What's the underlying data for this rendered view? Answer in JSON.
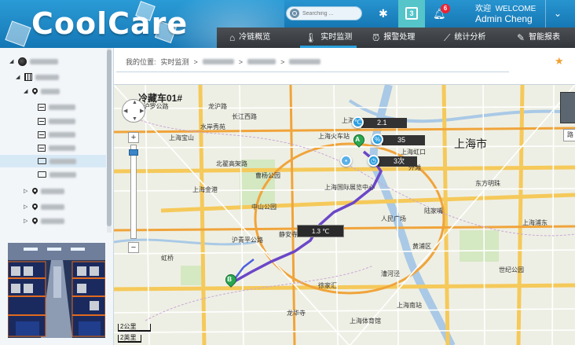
{
  "app": {
    "logo": "CoolCare"
  },
  "header": {
    "search_placeholder": "Searching ...",
    "calendar_day": "3",
    "notification_count": "6",
    "welcome_cn": "欢迎",
    "welcome_en": "WELCOME",
    "user_name": "Admin Cheng"
  },
  "nav": [
    {
      "label": "冷链概览",
      "icon": "home-icon"
    },
    {
      "label": "实时监测",
      "icon": "thermometer-icon",
      "active": true
    },
    {
      "label": "报警处理",
      "icon": "alarm-clock-icon"
    },
    {
      "label": "统计分析",
      "icon": "trend-chart-icon"
    },
    {
      "label": "智能报表",
      "icon": "report-icon"
    }
  ],
  "breadcrumb": {
    "prefix": "我的位置:",
    "current": "实时监测",
    "sep": ">"
  },
  "map": {
    "title": "冷藏车01#",
    "temp_reading": "2.1",
    "humidity_reading": "35",
    "alarm_count": "3次",
    "tooltip_temp": "1.3 ℃",
    "pin_a": "A",
    "pin_b": "B",
    "scale_km": "2公里",
    "scale_mi": "2英里",
    "city_label": "上海市",
    "map_type_button": "路",
    "labels": [
      "冷藏车01#",
      "2号沪罗公路",
      "龙沪路",
      "长江西路",
      "水岸秀苑",
      "上海宝山",
      "上海金港",
      "曹杨公园",
      "上海火车站",
      "中山公园",
      "上海虹口",
      "静安寺",
      "上海站",
      "北翟高架路",
      "沪青平公路",
      "上海国际展览中心",
      "陆家嘴",
      "上海市",
      "东方明珠",
      "黄浦区",
      "世纪公园",
      "上海浦东",
      "外滩",
      "人民广场",
      "徐家汇",
      "虹桥",
      "漕河泾",
      "上海南站",
      "龙华寺",
      "上海体育馆"
    ]
  },
  "colors": {
    "brand": "#1a85c6",
    "nav_bg": "#3d4146",
    "accent": "#2aa0de",
    "calendar_bg": "#56c5c9",
    "badge": "#e22233"
  }
}
